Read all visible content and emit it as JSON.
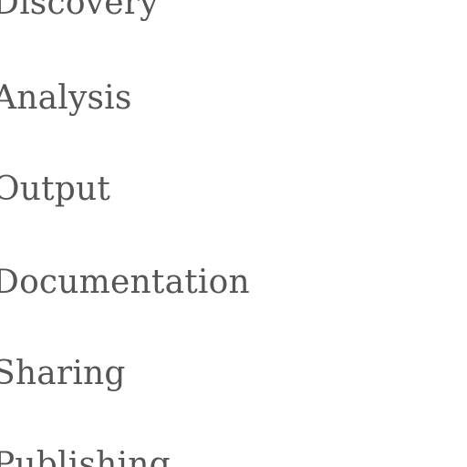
{
  "nav": {
    "items": [
      {
        "label": "Discovery"
      },
      {
        "label": "Analysis"
      },
      {
        "label": "Output"
      },
      {
        "label": "Documentation"
      },
      {
        "label": "Sharing"
      },
      {
        "label": "Publishing"
      }
    ]
  },
  "colors": {
    "background": "#ffffff",
    "text": "#555555"
  }
}
